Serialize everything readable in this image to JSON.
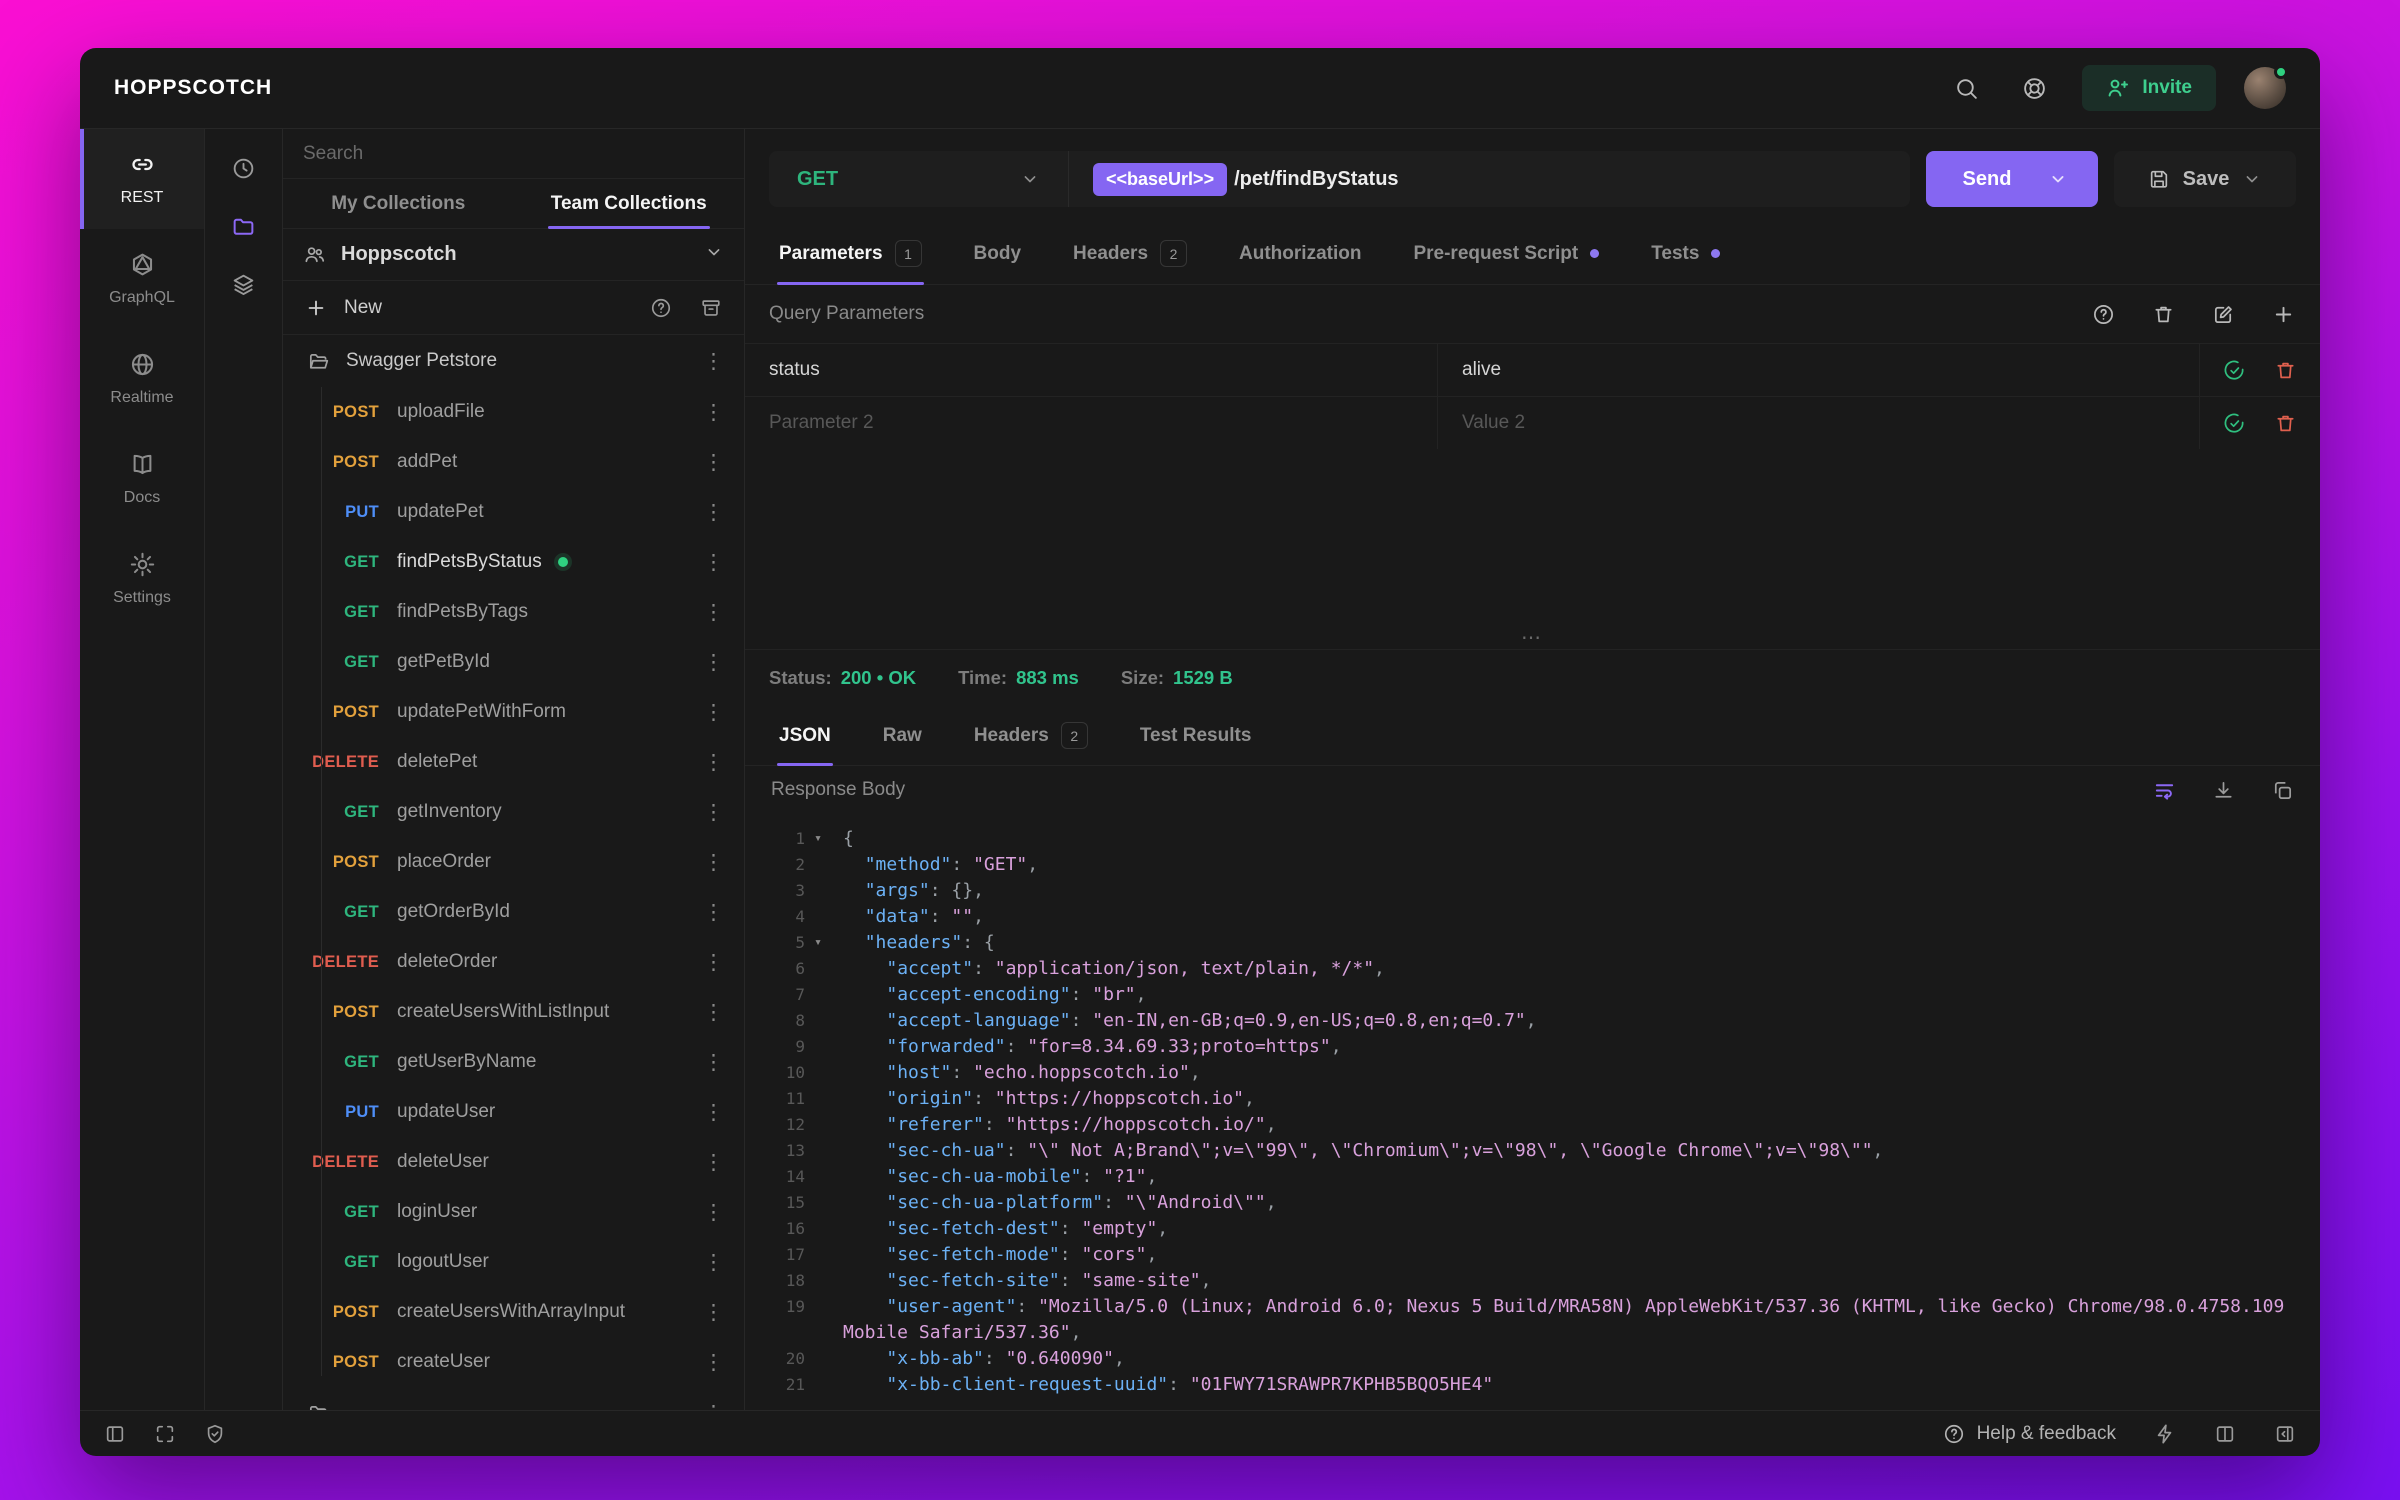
{
  "topbar": {
    "logo": "HOPPSCOTCH",
    "invite_label": "Invite"
  },
  "nav": {
    "items": [
      {
        "label": "REST",
        "active": true
      },
      {
        "label": "GraphQL"
      },
      {
        "label": "Realtime"
      },
      {
        "label": "Docs"
      },
      {
        "label": "Settings"
      }
    ]
  },
  "collections": {
    "search_placeholder": "Search",
    "tabs": [
      {
        "label": "My Collections",
        "active": false
      },
      {
        "label": "Team Collections",
        "active": true
      }
    ],
    "team_name": "Hoppscotch",
    "new_label": "New",
    "folder": "Swagger Petstore",
    "requests": [
      {
        "method": "POST",
        "name": "uploadFile"
      },
      {
        "method": "POST",
        "name": "addPet"
      },
      {
        "method": "PUT",
        "name": "updatePet"
      },
      {
        "method": "GET",
        "name": "findPetsByStatus",
        "active": true
      },
      {
        "method": "GET",
        "name": "findPetsByTags"
      },
      {
        "method": "GET",
        "name": "getPetById"
      },
      {
        "method": "POST",
        "name": "updatePetWithForm"
      },
      {
        "method": "DELETE",
        "name": "deletePet"
      },
      {
        "method": "GET",
        "name": "getInventory"
      },
      {
        "method": "POST",
        "name": "placeOrder"
      },
      {
        "method": "GET",
        "name": "getOrderById"
      },
      {
        "method": "DELETE",
        "name": "deleteOrder"
      },
      {
        "method": "POST",
        "name": "createUsersWithListInput"
      },
      {
        "method": "GET",
        "name": "getUserByName"
      },
      {
        "method": "PUT",
        "name": "updateUser"
      },
      {
        "method": "DELETE",
        "name": "deleteUser"
      },
      {
        "method": "GET",
        "name": "loginUser"
      },
      {
        "method": "GET",
        "name": "logoutUser"
      },
      {
        "method": "POST",
        "name": "createUsersWithArrayInput"
      },
      {
        "method": "POST",
        "name": "createUser"
      }
    ],
    "clipped_folder": ""
  },
  "request": {
    "method": "GET",
    "url_base": "<<baseUrl>>",
    "url_path": "/pet/findByStatus",
    "send_label": "Send",
    "save_label": "Save",
    "tabs": [
      {
        "label": "Parameters",
        "badge": "1",
        "active": true
      },
      {
        "label": "Body"
      },
      {
        "label": "Headers",
        "badge": "2"
      },
      {
        "label": "Authorization"
      },
      {
        "label": "Pre-request Script",
        "dot": true
      },
      {
        "label": "Tests",
        "dot": true
      }
    ],
    "section_title": "Query Parameters",
    "params": [
      {
        "key": "status",
        "value": "alive"
      },
      {
        "key_placeholder": "Parameter 2",
        "value_placeholder": "Value 2"
      }
    ]
  },
  "response": {
    "status_label": "Status:",
    "status_value": "200 • OK",
    "time_label": "Time:",
    "time_value": "883 ms",
    "size_label": "Size:",
    "size_value": "1529 B",
    "tabs": [
      {
        "label": "JSON",
        "active": true
      },
      {
        "label": "Raw"
      },
      {
        "label": "Headers",
        "badge": "2"
      },
      {
        "label": "Test Results"
      }
    ],
    "body_label": "Response Body",
    "code_lines": [
      {
        "n": 1,
        "fold": true,
        "segs": [
          [
            "p",
            "{"
          ]
        ]
      },
      {
        "n": 2,
        "segs": [
          [
            "p",
            "  "
          ],
          [
            "k",
            "\"method\""
          ],
          [
            "p",
            ": "
          ],
          [
            "s",
            "\"GET\""
          ],
          [
            "p",
            ","
          ]
        ]
      },
      {
        "n": 3,
        "segs": [
          [
            "p",
            "  "
          ],
          [
            "k",
            "\"args\""
          ],
          [
            "p",
            ": {},"
          ]
        ]
      },
      {
        "n": 4,
        "segs": [
          [
            "p",
            "  "
          ],
          [
            "k",
            "\"data\""
          ],
          [
            "p",
            ": "
          ],
          [
            "s",
            "\"\""
          ],
          [
            "p",
            ","
          ]
        ]
      },
      {
        "n": 5,
        "fold": true,
        "segs": [
          [
            "p",
            "  "
          ],
          [
            "k",
            "\"headers\""
          ],
          [
            "p",
            ": {"
          ]
        ]
      },
      {
        "n": 6,
        "segs": [
          [
            "p",
            "    "
          ],
          [
            "k",
            "\"accept\""
          ],
          [
            "p",
            ": "
          ],
          [
            "s",
            "\"application/json, text/plain, */*\""
          ],
          [
            "p",
            ","
          ]
        ]
      },
      {
        "n": 7,
        "segs": [
          [
            "p",
            "    "
          ],
          [
            "k",
            "\"accept-encoding\""
          ],
          [
            "p",
            ": "
          ],
          [
            "s",
            "\"br\""
          ],
          [
            "p",
            ","
          ]
        ]
      },
      {
        "n": 8,
        "segs": [
          [
            "p",
            "    "
          ],
          [
            "k",
            "\"accept-language\""
          ],
          [
            "p",
            ": "
          ],
          [
            "s",
            "\"en-IN,en-GB;q=0.9,en-US;q=0.8,en;q=0.7\""
          ],
          [
            "p",
            ","
          ]
        ]
      },
      {
        "n": 9,
        "segs": [
          [
            "p",
            "    "
          ],
          [
            "k",
            "\"forwarded\""
          ],
          [
            "p",
            ": "
          ],
          [
            "s",
            "\"for=8.34.69.33;proto=https\""
          ],
          [
            "p",
            ","
          ]
        ]
      },
      {
        "n": 10,
        "segs": [
          [
            "p",
            "    "
          ],
          [
            "k",
            "\"host\""
          ],
          [
            "p",
            ": "
          ],
          [
            "s",
            "\"echo.hoppscotch.io\""
          ],
          [
            "p",
            ","
          ]
        ]
      },
      {
        "n": 11,
        "segs": [
          [
            "p",
            "    "
          ],
          [
            "k",
            "\"origin\""
          ],
          [
            "p",
            ": "
          ],
          [
            "s",
            "\"https://hoppscotch.io\""
          ],
          [
            "p",
            ","
          ]
        ]
      },
      {
        "n": 12,
        "segs": [
          [
            "p",
            "    "
          ],
          [
            "k",
            "\"referer\""
          ],
          [
            "p",
            ": "
          ],
          [
            "s",
            "\"https://hoppscotch.io/\""
          ],
          [
            "p",
            ","
          ]
        ]
      },
      {
        "n": 13,
        "segs": [
          [
            "p",
            "    "
          ],
          [
            "k",
            "\"sec-ch-ua\""
          ],
          [
            "p",
            ": "
          ],
          [
            "s",
            "\"\\\" Not A;Brand\\\";v=\\\"99\\\", \\\"Chromium\\\";v=\\\"98\\\", \\\"Google Chrome\\\";v=\\\"98\\\"\""
          ],
          [
            "p",
            ","
          ]
        ]
      },
      {
        "n": 14,
        "segs": [
          [
            "p",
            "    "
          ],
          [
            "k",
            "\"sec-ch-ua-mobile\""
          ],
          [
            "p",
            ": "
          ],
          [
            "s",
            "\"?1\""
          ],
          [
            "p",
            ","
          ]
        ]
      },
      {
        "n": 15,
        "segs": [
          [
            "p",
            "    "
          ],
          [
            "k",
            "\"sec-ch-ua-platform\""
          ],
          [
            "p",
            ": "
          ],
          [
            "s",
            "\"\\\"Android\\\"\""
          ],
          [
            "p",
            ","
          ]
        ]
      },
      {
        "n": 16,
        "segs": [
          [
            "p",
            "    "
          ],
          [
            "k",
            "\"sec-fetch-dest\""
          ],
          [
            "p",
            ": "
          ],
          [
            "s",
            "\"empty\""
          ],
          [
            "p",
            ","
          ]
        ]
      },
      {
        "n": 17,
        "segs": [
          [
            "p",
            "    "
          ],
          [
            "k",
            "\"sec-fetch-mode\""
          ],
          [
            "p",
            ": "
          ],
          [
            "s",
            "\"cors\""
          ],
          [
            "p",
            ","
          ]
        ]
      },
      {
        "n": 18,
        "segs": [
          [
            "p",
            "    "
          ],
          [
            "k",
            "\"sec-fetch-site\""
          ],
          [
            "p",
            ": "
          ],
          [
            "s",
            "\"same-site\""
          ],
          [
            "p",
            ","
          ]
        ]
      },
      {
        "n": 19,
        "segs": [
          [
            "p",
            "    "
          ],
          [
            "k",
            "\"user-agent\""
          ],
          [
            "p",
            ": "
          ],
          [
            "s",
            "\"Mozilla/5.0 (Linux; Android 6.0; Nexus 5 Build/MRA58N) AppleWebKit/537.36 (KHTML, like Gecko) Chrome/98.0.4758.109 Mobile Safari/537.36\""
          ],
          [
            "p",
            ","
          ]
        ]
      },
      {
        "n": 20,
        "segs": [
          [
            "p",
            "    "
          ],
          [
            "k",
            "\"x-bb-ab\""
          ],
          [
            "p",
            ": "
          ],
          [
            "s",
            "\"0.640090\""
          ],
          [
            "p",
            ","
          ]
        ]
      },
      {
        "n": 21,
        "segs": [
          [
            "p",
            "    "
          ],
          [
            "k",
            "\"x-bb-client-request-uuid\""
          ],
          [
            "p",
            ": "
          ],
          [
            "s",
            "\"01FWY71SRAWPR7KPHB5BQO5HE4\""
          ]
        ]
      }
    ]
  },
  "statusbar": {
    "help_label": "Help & feedback"
  },
  "colors": {
    "accent": "#8566f2",
    "status_green": "#31c48d",
    "methods": {
      "GET": "#2eb57d",
      "POST": "#e3a13c",
      "PUT": "#4e8ef7",
      "DELETE": "#e05d4f"
    }
  }
}
